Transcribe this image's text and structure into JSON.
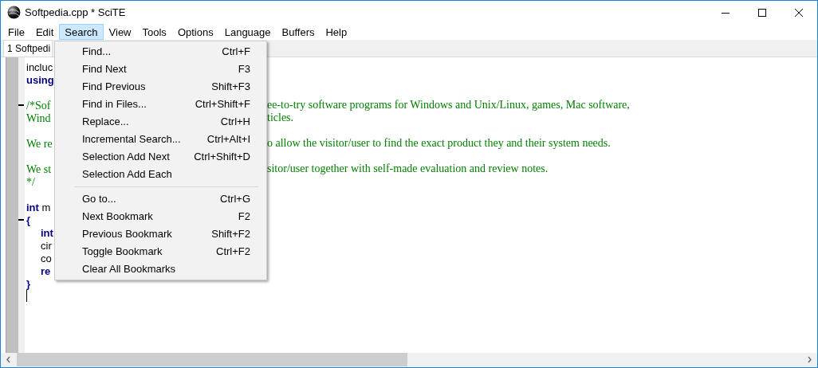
{
  "window": {
    "title": "Softpedia.cpp * SciTE"
  },
  "menu_bar": [
    {
      "label": "File",
      "selected": false
    },
    {
      "label": "Edit",
      "selected": false
    },
    {
      "label": "Search",
      "selected": true
    },
    {
      "label": "View",
      "selected": false
    },
    {
      "label": "Tools",
      "selected": false
    },
    {
      "label": "Options",
      "selected": false
    },
    {
      "label": "Language",
      "selected": false
    },
    {
      "label": "Buffers",
      "selected": false
    },
    {
      "label": "Help",
      "selected": false
    }
  ],
  "tabs": [
    {
      "label": "1 Softpedi",
      "selected": true
    }
  ],
  "editor": {
    "lines": [
      {
        "kind": "code",
        "fold": false,
        "left": "incluc"
      },
      {
        "kind": "keyword",
        "fold": false,
        "left": "using"
      },
      {
        "kind": "blank",
        "fold": false
      },
      {
        "kind": "comment",
        "fold": true,
        "left": "/*Sof",
        "right": "ee-to-try software programs for Windows and Unix/Linux, games, Mac software,"
      },
      {
        "kind": "comment",
        "fold": false,
        "left": "Wind",
        "right": "ticles."
      },
      {
        "kind": "blank",
        "fold": false
      },
      {
        "kind": "comment",
        "fold": false,
        "left": "We re",
        "right": "o allow the visitor/user to find the exact product they and their system needs."
      },
      {
        "kind": "blank",
        "fold": false
      },
      {
        "kind": "comment",
        "fold": false,
        "left": "We st",
        "right": "sitor/user together with self-made evaluation and review notes."
      },
      {
        "kind": "comment",
        "fold": false,
        "left": "*/"
      },
      {
        "kind": "blank",
        "fold": false
      },
      {
        "kind": "code",
        "fold": false,
        "left": "**int** m"
      },
      {
        "kind": "code",
        "fold": true,
        "left": "**{**"
      },
      {
        "kind": "keyword",
        "fold": false,
        "indent": true,
        "left": "int"
      },
      {
        "kind": "code",
        "fold": false,
        "indent": true,
        "left": "cir"
      },
      {
        "kind": "code",
        "fold": false,
        "indent": true,
        "left": "co"
      },
      {
        "kind": "keyword",
        "fold": false,
        "indent": true,
        "left": "re"
      },
      {
        "kind": "code",
        "fold": false,
        "left": "**}**"
      }
    ]
  },
  "search_menu": {
    "groups": [
      [
        {
          "label": "Find...",
          "shortcut": "Ctrl+F"
        },
        {
          "label": "Find Next",
          "shortcut": "F3"
        },
        {
          "label": "Find Previous",
          "shortcut": "Shift+F3"
        },
        {
          "label": "Find in Files...",
          "shortcut": "Ctrl+Shift+F"
        },
        {
          "label": "Replace...",
          "shortcut": "Ctrl+H"
        },
        {
          "label": "Incremental Search...",
          "shortcut": "Ctrl+Alt+I"
        },
        {
          "label": "Selection Add Next",
          "shortcut": "Ctrl+Shift+D"
        },
        {
          "label": "Selection Add Each"
        }
      ],
      [
        {
          "label": "Go to...",
          "shortcut": "Ctrl+G"
        },
        {
          "label": "Next Bookmark",
          "shortcut": "F2"
        },
        {
          "label": "Previous Bookmark",
          "shortcut": "Shift+F2"
        },
        {
          "label": "Toggle Bookmark",
          "shortcut": "Ctrl+F2"
        },
        {
          "label": "Clear All Bookmarks"
        }
      ]
    ]
  }
}
